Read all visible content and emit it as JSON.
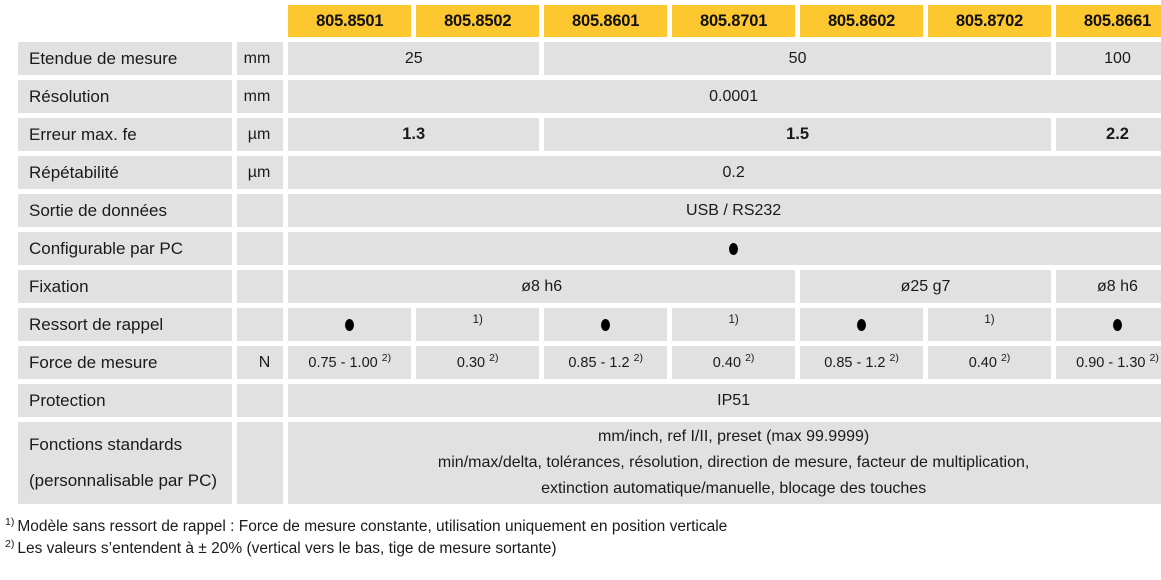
{
  "table": {
    "models": [
      "805.8501",
      "805.8502",
      "805.8601",
      "805.8701",
      "805.8602",
      "805.8702",
      "805.8661"
    ],
    "colors": {
      "header_yellow": "#fdc82f",
      "cell_gray": "#e1e1e1",
      "text": "#1a1a1a",
      "page_background": "#ffffff"
    },
    "rows": [
      {
        "label": "Etendue de mesure",
        "unit": "mm",
        "cells": [
          {
            "text": "25",
            "span": 2
          },
          {
            "text": "50",
            "span": 4
          },
          {
            "text": "100",
            "span": 1
          }
        ]
      },
      {
        "label": "Résolution",
        "unit": "mm",
        "cells": [
          {
            "text": "0.0001",
            "span": 7
          }
        ]
      },
      {
        "label": "Erreur max. fe",
        "unit": "µm",
        "bold": true,
        "cells": [
          {
            "text": "1.3",
            "span": 2
          },
          {
            "text": "1.5",
            "span": 4
          },
          {
            "text": "2.2",
            "span": 1
          }
        ]
      },
      {
        "label": "Répétabilité",
        "unit": "µm",
        "cells": [
          {
            "text": "0.2",
            "span": 7
          }
        ]
      },
      {
        "label": "Sortie de données",
        "unit": "",
        "cells": [
          {
            "text": "USB / RS232",
            "span": 7
          }
        ]
      },
      {
        "label": "Configurable par PC",
        "unit": "",
        "cells": [
          {
            "text": "",
            "span": 7,
            "dot": true
          }
        ]
      },
      {
        "label": "Fixation",
        "unit": "",
        "cells": [
          {
            "text": "ø8 h6",
            "span": 4
          },
          {
            "text": "ø25 g7",
            "span": 2
          },
          {
            "text": "ø8 h6",
            "span": 1
          }
        ]
      },
      {
        "label": "Ressort de rappel",
        "unit": "",
        "cells": [
          {
            "text": "",
            "span": 1,
            "dot": true
          },
          {
            "text": "1)",
            "span": 1,
            "superscript_only": true
          },
          {
            "text": "",
            "span": 1,
            "dot": true
          },
          {
            "text": "1)",
            "span": 1,
            "superscript_only": true
          },
          {
            "text": "",
            "span": 1,
            "dot": true
          },
          {
            "text": "1)",
            "span": 1,
            "superscript_only": true
          },
          {
            "text": "",
            "span": 1,
            "dot": true
          }
        ]
      },
      {
        "label": "Force de mesure",
        "unit": "N",
        "small": true,
        "cells": [
          {
            "text": "0.75 - 1.00",
            "footnote": "2)",
            "span": 1
          },
          {
            "text": "0.30",
            "footnote": "2)",
            "span": 1
          },
          {
            "text": "0.85 - 1.2",
            "footnote": "2)",
            "span": 1
          },
          {
            "text": "0.40",
            "footnote": "2)",
            "span": 1
          },
          {
            "text": "0.85 - 1.2",
            "footnote": "2)",
            "span": 1
          },
          {
            "text": "0.40",
            "footnote": "2)",
            "span": 1
          },
          {
            "text": "0.90 - 1.30",
            "footnote": "2)",
            "span": 1
          }
        ]
      },
      {
        "label": "Protection",
        "unit": "",
        "cells": [
          {
            "text": "IP51",
            "span": 7
          }
        ]
      }
    ],
    "functions_row": {
      "label_line1": "Fonctions standards",
      "label_line2": "(personnalisable par PC)",
      "unit": "",
      "lines": [
        "mm/inch, ref I/II, preset (max 99.9999)",
        "min/max/delta, tolérances, résolution, direction de mesure, facteur de multiplication,",
        "extinction automatique/manuelle, blocage des touches"
      ]
    }
  },
  "footnotes": [
    {
      "marker": "1)",
      "text": "Modèle sans ressort de rappel : Force de mesure constante, utilisation uniquement en position verticale"
    },
    {
      "marker": "2)",
      "text": "Les valeurs s’entendent à ± 20% (vertical vers le bas, tige de mesure sortante)"
    }
  ]
}
